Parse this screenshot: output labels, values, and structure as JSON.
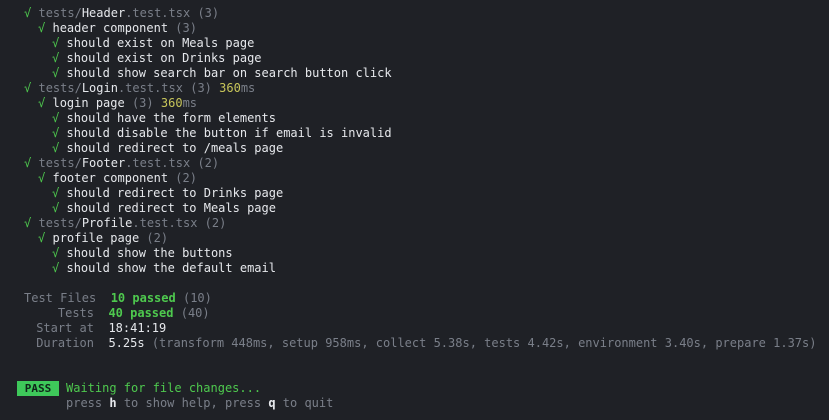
{
  "results": [
    {
      "indent": 0,
      "prefix": "tests/",
      "name": "Header",
      "suffix": ".test.tsx",
      "count": "(3)",
      "time": "",
      "time_unit": ""
    },
    {
      "indent": 1,
      "label": "header component",
      "count": "(3)",
      "time": "",
      "time_unit": ""
    },
    {
      "indent": 2,
      "label": "should exist on Meals page"
    },
    {
      "indent": 2,
      "label": "should exist on Drinks page"
    },
    {
      "indent": 2,
      "label": "should show search bar on search button click"
    },
    {
      "indent": 0,
      "prefix": "tests/",
      "name": "Login",
      "suffix": ".test.tsx",
      "count": "(3)",
      "time": "360",
      "time_unit": "ms"
    },
    {
      "indent": 1,
      "label": "login page",
      "count": "(3)",
      "time": "360",
      "time_unit": "ms"
    },
    {
      "indent": 2,
      "label": "should have the form elements"
    },
    {
      "indent": 2,
      "label": "should disable the button if email is invalid"
    },
    {
      "indent": 2,
      "label": "should redirect to /meals page"
    },
    {
      "indent": 0,
      "prefix": "tests/",
      "name": "Footer",
      "suffix": ".test.tsx",
      "count": "(2)",
      "time": "",
      "time_unit": ""
    },
    {
      "indent": 1,
      "label": "footer component",
      "count": "(2)",
      "time": "",
      "time_unit": ""
    },
    {
      "indent": 2,
      "label": "should redirect to Drinks page"
    },
    {
      "indent": 2,
      "label": "should redirect to Meals page"
    },
    {
      "indent": 0,
      "prefix": "tests/",
      "name": "Profile",
      "suffix": ".test.tsx",
      "count": "(2)",
      "time": "",
      "time_unit": ""
    },
    {
      "indent": 1,
      "label": "profile page",
      "count": "(2)",
      "time": "",
      "time_unit": ""
    },
    {
      "indent": 2,
      "label": "should show the buttons"
    },
    {
      "indent": 2,
      "label": "should show the default email"
    }
  ],
  "check_glyph": "√",
  "summary": {
    "test_files_label": "Test Files",
    "test_files_value": "10 passed",
    "test_files_total": "(10)",
    "tests_label": "Tests",
    "tests_value": "40 passed",
    "tests_total": "(40)",
    "start_label": "Start at",
    "start_value": "18:41:19",
    "duration_label": "Duration",
    "duration_value": "5.25s",
    "duration_detail": "(transform 448ms, setup 958ms, collect 5.38s, tests 4.42s, environment 3.40s, prepare 1.37s)"
  },
  "footer": {
    "badge": "PASS",
    "waiting": "Waiting for file changes...",
    "help_1": "press ",
    "help_key_1": "h",
    "help_2": " to show help, press ",
    "help_key_2": "q",
    "help_3": " to quit"
  },
  "colors": {
    "background": "#1f2126",
    "pass": "#4ec94e",
    "badge_bg": "#3ec85a",
    "dim": "#7a7f89",
    "time": "#c8c65a"
  }
}
